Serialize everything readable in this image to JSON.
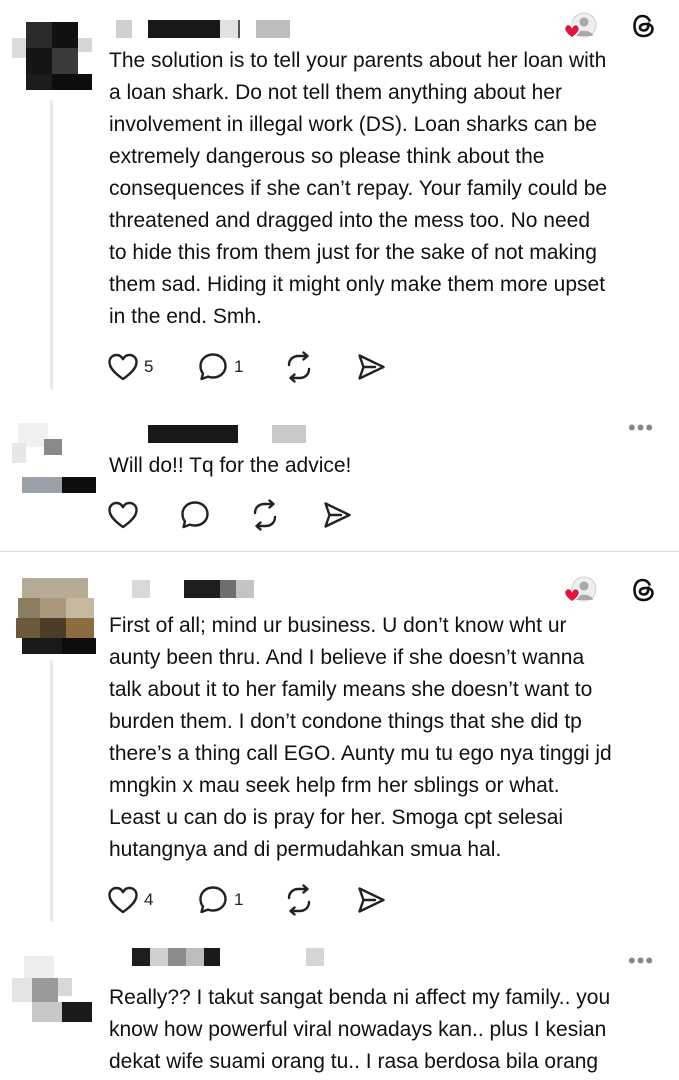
{
  "posts": [
    {
      "id": "p1",
      "body": "The solution is to tell your parents about her loan with\na loan shark. Do not tell them anything about her\ninvolvement in illegal work (DS). Loan sharks can be\nextremely dangerous so please think about the\nconsequences if she can’t repay. Your family could be\nthreatened and dragged into the mess too. No need\nto hide this from them just for the sake of not making\nthem sad. Hiding it might only make them more upset\nin the end. Smh.",
      "likes": "5",
      "replies": "1",
      "liked_by_author": true
    },
    {
      "id": "p2",
      "body": "Will do!! Tq for the advice!",
      "likes": "",
      "replies": ""
    },
    {
      "id": "p3",
      "body": "First of all; mind ur business. U don’t know wht ur\naunty been thru. And I believe if she doesn’t wanna\ntalk about it to her family means she doesn’t want to\nburden them. I don’t condone things that she did tp\nthere’s a thing call EGO. Aunty mu tu ego nya tinggi jd\nmngkin x mau seek help frm her sblings or what.\nLeast u can do is pray for her. Smoga cpt selesai\nhutangnya and di permudahkan smua hal.",
      "likes": "4",
      "replies": "1",
      "liked_by_author": true
    },
    {
      "id": "p4",
      "body": "Really?? I takut sangat benda ni affect my family.. you\nknow how powerful viral nowadays kan.. plus I kesian\ndekat wife suami orang tu.. I rasa berdosa bila orang",
      "likes": "",
      "replies": ""
    }
  ],
  "icons": {
    "like": "heart-outline-icon",
    "reply": "speech-bubble-icon",
    "repost": "repost-arrows-icon",
    "share": "send-arrow-icon",
    "threads": "threads-logo-icon",
    "more": "more-dots-icon",
    "liked_by_author": "heart-with-avatar-icon"
  },
  "colors": {
    "text": "#111111",
    "heart_badge": "#e0143c",
    "icon": "#222222",
    "muted": "#888888",
    "divider": "#dcdcdc"
  }
}
